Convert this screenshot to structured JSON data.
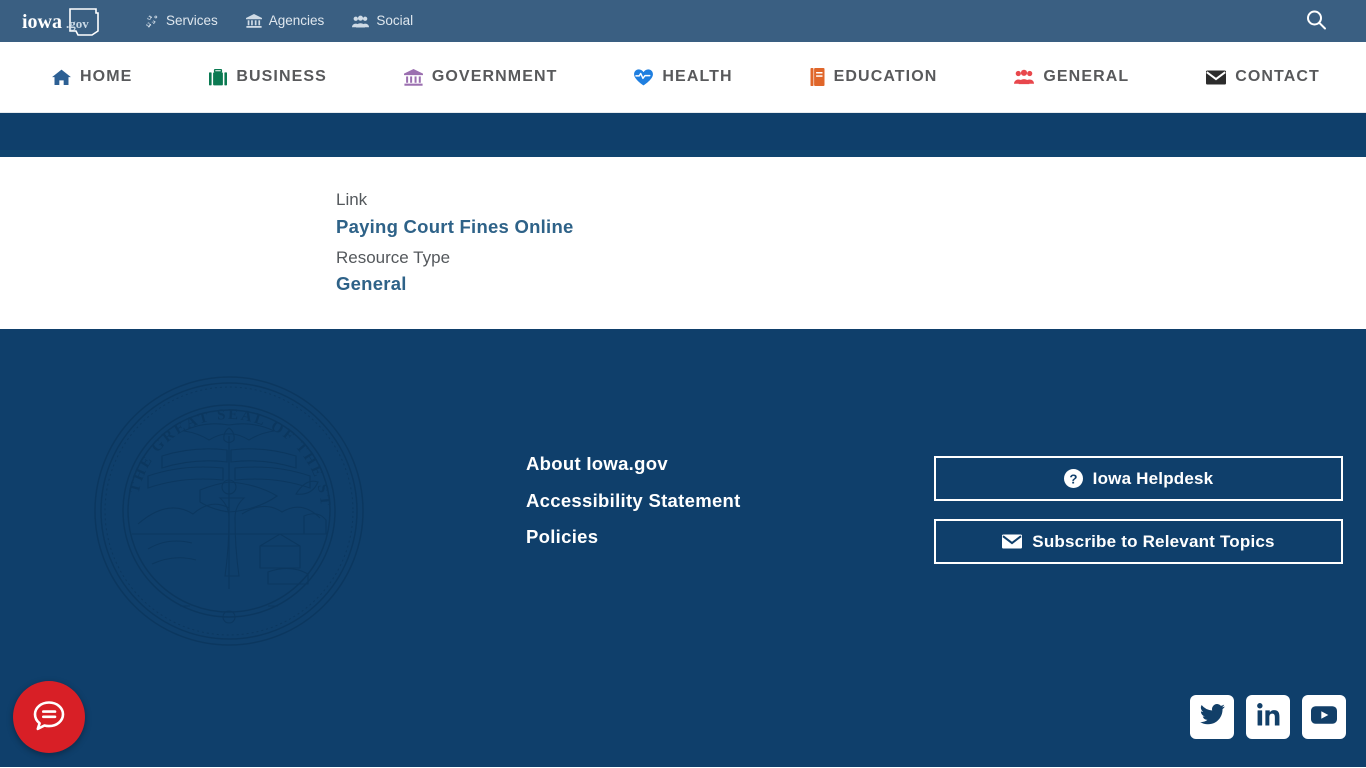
{
  "utility_bar": {
    "logo_text": "iowa.gov",
    "logo_icon": "iowa-state-outline-logo",
    "links": [
      {
        "label": "Services",
        "icon": "cogs-icon"
      },
      {
        "label": "Agencies",
        "icon": "bank-icon"
      },
      {
        "label": "Social",
        "icon": "users-icon"
      }
    ],
    "search": {
      "icon": "search-icon",
      "label": "Search"
    }
  },
  "main_nav": {
    "items": [
      {
        "label": "HOME",
        "icon": "home-icon",
        "color": "#2d6094"
      },
      {
        "label": "BUSINESS",
        "icon": "briefcase-icon",
        "color": "#0b7a52"
      },
      {
        "label": "GOVERNMENT",
        "icon": "bank-icon",
        "color": "#9b6fb0"
      },
      {
        "label": "HEALTH",
        "icon": "heartbeat-icon",
        "color": "#1f7fe0"
      },
      {
        "label": "EDUCATION",
        "icon": "book-icon",
        "color": "#e0662a"
      },
      {
        "label": "GENERAL",
        "icon": "users-icon",
        "color": "#e8474c"
      },
      {
        "label": "CONTACT",
        "icon": "envelope-icon",
        "color": "#2c2c2c"
      }
    ]
  },
  "content": {
    "fields": [
      {
        "label": "Link",
        "value": "Paying Court Fines Online",
        "is_link": true
      },
      {
        "label": "Resource Type",
        "value": "General",
        "is_link": true
      }
    ]
  },
  "footer": {
    "seal_icon": "iowa-great-seal",
    "seal_alt": "The Great Seal of the State of Iowa",
    "links": [
      {
        "label": "About Iowa.gov"
      },
      {
        "label": "Accessibility Statement"
      },
      {
        "label": "Policies"
      }
    ],
    "buttons": [
      {
        "label": "Iowa Helpdesk",
        "icon": "question-circle-icon"
      },
      {
        "label": "Subscribe to Relevant Topics",
        "icon": "envelope-icon"
      }
    ],
    "social": [
      {
        "name": "Twitter",
        "icon": "twitter-icon"
      },
      {
        "name": "LinkedIn",
        "icon": "linkedin-icon"
      },
      {
        "name": "YouTube",
        "icon": "youtube-icon"
      }
    ],
    "chat": {
      "icon": "chat-bubble-icon",
      "label": "Open chat"
    }
  },
  "colors": {
    "utility_bar_bg": "#3a5f82",
    "band_bg": "#0f3f6b",
    "footer_bg": "#0f3f6b",
    "link_blue": "#2e6288",
    "label_gray": "#54585c",
    "nav_text": "#58595b",
    "chat_red": "#d81f26"
  }
}
